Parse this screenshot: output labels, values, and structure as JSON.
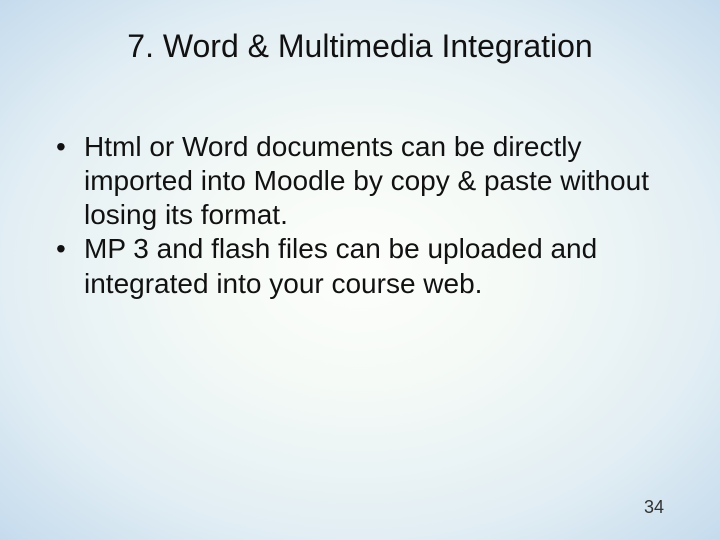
{
  "slide": {
    "title": "7. Word & Multimedia Integration",
    "bullets": [
      "Html or Word documents can be directly imported into Moodle by copy & paste without losing its format.",
      "MP 3 and flash files can be uploaded and integrated into your course web."
    ],
    "page_number": "34"
  }
}
